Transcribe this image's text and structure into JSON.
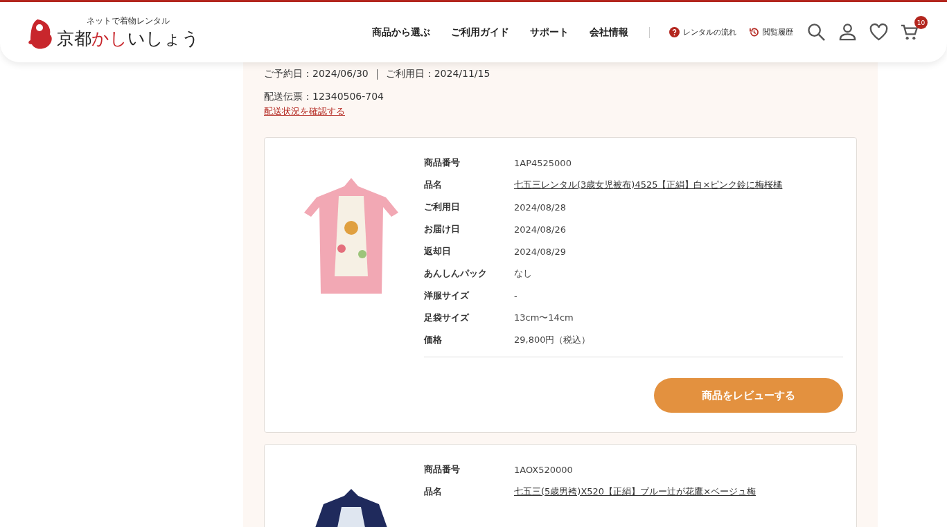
{
  "header": {
    "logo_tagline": "ネットで着物レンタル",
    "logo_name": "京都",
    "logo_name_accent": "かし",
    "logo_name_rest": "いしょう",
    "nav": [
      "商品から選ぶ",
      "ご利用ガイド",
      "サポート",
      "会社情報"
    ],
    "links": [
      {
        "kind": "help",
        "label": "レンタルの流れ"
      },
      {
        "kind": "history",
        "label": "閲覧履歴"
      }
    ],
    "cart_count": "10"
  },
  "order": {
    "reserved": "ご予約日：2024/06/30",
    "use_date": "ご利用日：2024/11/15",
    "slip": "配送伝票：12340506-704",
    "tracking_link": "配送状況を確認する"
  },
  "products": [
    {
      "fields": [
        {
          "label": "商品番号",
          "value": "1AP4525000",
          "kind": "text"
        },
        {
          "label": "品名",
          "value": "七五三レンタル(3歳女児被布)4525【正絹】白×ピンク鈴に梅桜橘",
          "kind": "link"
        },
        {
          "label": "ご利用日",
          "value": "2024/08/28",
          "kind": "text"
        },
        {
          "label": "お届け日",
          "value": "2024/08/26",
          "kind": "text"
        },
        {
          "label": "返却日",
          "value": "2024/08/29",
          "kind": "text"
        },
        {
          "label": "あんしんパック",
          "value": "なし",
          "kind": "text"
        },
        {
          "label": "洋服サイズ",
          "value": "-",
          "kind": "text"
        },
        {
          "label": "足袋サイズ",
          "value": "13cm〜14cm",
          "kind": "text"
        },
        {
          "label": "価格",
          "value": "29,800円（税込）",
          "kind": "text"
        }
      ],
      "button": "商品をレビューする"
    },
    {
      "fields": [
        {
          "label": "商品番号",
          "value": "1AOX520000",
          "kind": "text"
        },
        {
          "label": "品名",
          "value": "七五三(5歳男袴)X520【正絹】ブルー辻が花鷹×ベージュ梅",
          "kind": "link"
        }
      ]
    }
  ]
}
